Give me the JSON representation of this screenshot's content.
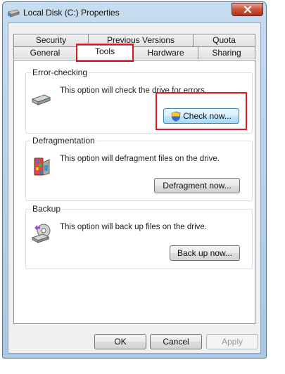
{
  "window": {
    "title": "Local Disk (C:) Properties",
    "close_symbol": "✕",
    "icon": "drive-icon"
  },
  "tabs": {
    "row_back": [
      {
        "label": "Security"
      },
      {
        "label": "Previous Versions"
      },
      {
        "label": "Quota"
      }
    ],
    "row_front": [
      {
        "label": "General"
      },
      {
        "label": "Tools",
        "active": true
      },
      {
        "label": "Hardware"
      },
      {
        "label": "Sharing"
      }
    ]
  },
  "error_checking": {
    "title": "Error-checking",
    "description": "This option will check the drive for errors.",
    "button": "Check now...",
    "icon": "disk-check-icon"
  },
  "defragmentation": {
    "title": "Defragmentation",
    "description": "This option will defragment files on the drive.",
    "button": "Defragment now...",
    "icon": "defragment-icon"
  },
  "backup": {
    "title": "Backup",
    "description": "This option will back up files on the drive.",
    "button": "Back up now...",
    "icon": "backup-icon"
  },
  "footer": {
    "ok": "OK",
    "cancel": "Cancel",
    "apply": "Apply"
  },
  "colors": {
    "highlight": "#e3161d",
    "titlebar": "#b9d1ea",
    "close_button": "#c8533a"
  }
}
